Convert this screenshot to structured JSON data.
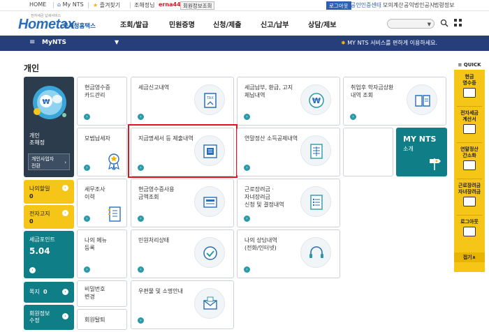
{
  "util": {
    "home": "HOME",
    "mynts": "My NTS",
    "fav": "즐겨찾기",
    "user_prefix": "조해정님",
    "user_id": "erna44",
    "member_info": "회원정보조회",
    "logout": "로그아웃",
    "cert_center": "공인인증센터",
    "mock_calc": "모의계산",
    "corp_notice": "공익법인공시",
    "law_info": "법령정보"
  },
  "brand": {
    "tagline": "전자세금 납세서비스",
    "logo_text": "Hometax",
    "logo_kr": "국세청홈택스",
    "color": "#2a6ebb"
  },
  "gnb": [
    "조회/발급",
    "민원증명",
    "신청/제출",
    "신고/납부",
    "상담/제보"
  ],
  "subbar": {
    "title": "MyNTS",
    "message": "MY NTS 서비스를 편하게 이용하세요.",
    "bg": "#263f7c"
  },
  "page_title": "개인",
  "profile": {
    "line1": "개인\n조해정",
    "button": "개인사업자\n전환"
  },
  "left": {
    "tax_return": {
      "label": "나의할일",
      "count": "0"
    },
    "e_notice": {
      "label": "전자고지",
      "count": "0"
    },
    "points": {
      "label": "세금포인트",
      "value": "5.04"
    },
    "note": {
      "label": "쪽지",
      "count": "0"
    },
    "member_edit": {
      "label": "회원정보\n수정"
    }
  },
  "cards": {
    "c1": "현금영수증\n카드관리",
    "c2": "세금신고내역",
    "c3": "세금납부, 환급, 고지\n체납내역",
    "c4": "취업후 학자금상환\n내역 조회",
    "c5": "모범납세자",
    "c6": "지급명세서 등 제출내역",
    "c7": "연말정산 소득공제내역",
    "c8": "세무조사\n이력",
    "c9": "현금영수증사용\n금액조회",
    "c10": "근로장려금 ·\n자녀장려금\n신청 및 결정내역",
    "c11": "나의 메뉴\n등록",
    "c12": "민원처리상태",
    "c13": "나의 상담내역\n(전화/인터넷)",
    "c14": "비밀번호\n변경",
    "c15": "우편물 및 소명안내",
    "c16": "회원탈퇴"
  },
  "mynts_card": {
    "title": "MY NTS",
    "sub": "소개"
  },
  "quick": {
    "header": "QUICK",
    "items": [
      "현금\n영수증",
      "전자세금\n계산서",
      "연말정산\n간소화",
      "근로장려금\n자녀장려금",
      "로그아웃"
    ],
    "close": "접기∧"
  },
  "colors": {
    "accent_teal": "#0f7e86",
    "accent_yellow": "#f5c518",
    "highlight": "#e0141c"
  }
}
